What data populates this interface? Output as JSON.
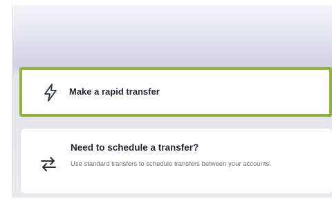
{
  "rapid_transfer": {
    "label": "Make a rapid transfer",
    "icon": "lightning-bolt-icon"
  },
  "schedule_transfer": {
    "title": "Need to schedule a transfer?",
    "description": "Use standard transfers to schedule transfers between your accounts.",
    "icon": "swap-arrows-icon"
  },
  "colors": {
    "selected_border": "#8fb339",
    "card_background": "#ffffff",
    "title_text": "#1f2430",
    "description_text": "#6a6e78"
  }
}
